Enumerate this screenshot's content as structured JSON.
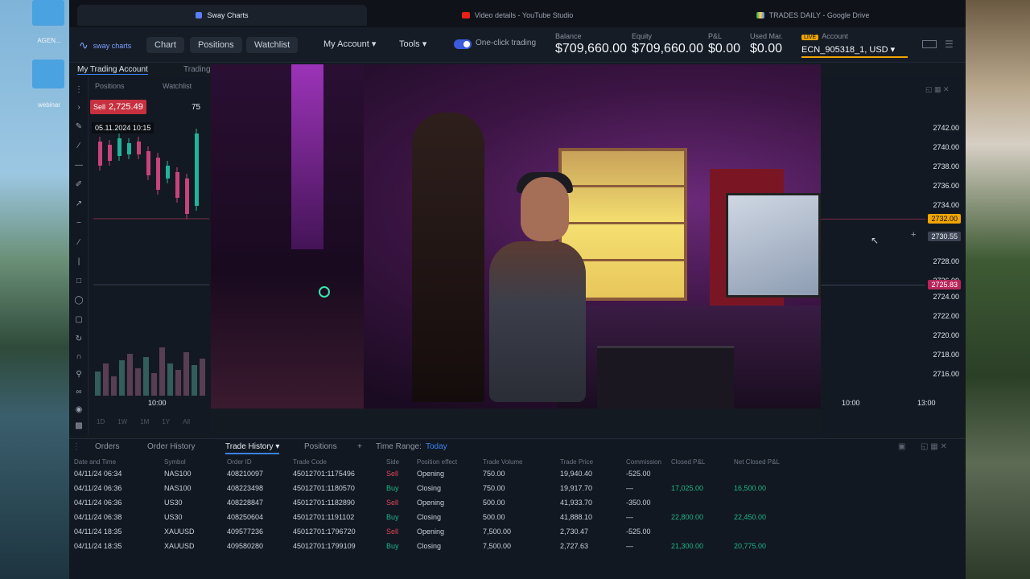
{
  "desktop": {
    "icons": [
      {
        "label": ""
      },
      {
        "label": "AGEN..."
      },
      {
        "label": "webinar"
      }
    ]
  },
  "tabs": [
    {
      "label": "Sway Charts",
      "active": true
    },
    {
      "label": "Video details - YouTube Studio",
      "active": false
    },
    {
      "label": "TRADES DAILY - Google Drive",
      "active": false
    }
  ],
  "header": {
    "logo_text": "sway charts",
    "nav": {
      "chart": "Chart",
      "positions": "Positions",
      "watchlist": "Watchlist"
    },
    "menus": {
      "my_account": "My Account ▾",
      "tools": "Tools ▾"
    },
    "one_click": "One-click trading",
    "stats": [
      {
        "key": "Balance",
        "value": "$709,660.00"
      },
      {
        "key": "Equity",
        "value": "$709,660.00"
      },
      {
        "key": "P&L",
        "value": "$0.00"
      },
      {
        "key": "Used Mar.",
        "value": "$0.00"
      }
    ],
    "account_live": "LIVE",
    "account_label": "Account",
    "account_value": "ECN_905318_1, USD ▾"
  },
  "chart": {
    "sub_tabs": {
      "account": "My Trading Account",
      "trading": "Trading"
    },
    "side_tabs": {
      "positions": "Positions",
      "watchlist": "Watchlist"
    },
    "sell_label": "Sell",
    "sell_price": "2,725.49",
    "quantity": "75",
    "date_badge": "05.11.2024 10:15",
    "price_ticks": [
      "2742.00",
      "2740.00",
      "2738.00",
      "2736.00",
      "2734.00",
      "2728.00",
      "2726.00",
      "2724.00",
      "2722.00",
      "2720.00",
      "2718.00",
      "2716.00"
    ],
    "badge_sell": "2732.00",
    "badge_cur": "2730.55",
    "badge_buy": "2725.83",
    "time_labels": [
      "10:00",
      "10:00",
      "13:00"
    ],
    "periods": [
      "1D",
      "1W",
      "1M",
      "1Y",
      "All"
    ]
  },
  "bottom": {
    "tabs": {
      "orders": "Orders",
      "order_history": "Order History",
      "trade_history": "Trade History ▾",
      "positions": "Positions",
      "time_range_label": "Time Range:",
      "time_range_value": "Today"
    },
    "headers": [
      "Date and Time",
      "Symbol",
      "Order ID",
      "Trade Code",
      "Side",
      "Position effect",
      "Trade Volume",
      "Trade Price",
      "Commission",
      "Closed P&L",
      "Net Closed P&L"
    ],
    "rows": [
      [
        "04/11/24 06:34",
        "NAS100",
        "408210097",
        "45012701:1175496",
        "Sell",
        "Opening",
        "750.00",
        "19,940.40",
        "-525.00",
        "",
        ""
      ],
      [
        "04/11/24 06:36",
        "NAS100",
        "408223498",
        "45012701:1180570",
        "Buy",
        "Closing",
        "750.00",
        "19,917.70",
        "—",
        "17,025.00",
        "16,500.00"
      ],
      [
        "04/11/24 06:36",
        "US30",
        "408228847",
        "45012701:1182890",
        "Sell",
        "Opening",
        "500.00",
        "41,933.70",
        "-350.00",
        "",
        ""
      ],
      [
        "04/11/24 06:38",
        "US30",
        "408250604",
        "45012701:1191102",
        "Buy",
        "Closing",
        "500.00",
        "41,888.10",
        "—",
        "22,800.00",
        "22,450.00"
      ],
      [
        "04/11/24 18:35",
        "XAUUSD",
        "409577236",
        "45012701:1796720",
        "Sell",
        "Opening",
        "7,500.00",
        "2,730.47",
        "-525.00",
        "",
        ""
      ],
      [
        "04/11/24 18:35",
        "XAUUSD",
        "409580280",
        "45012701:1799109",
        "Buy",
        "Closing",
        "7,500.00",
        "2,727.63",
        "—",
        "21,300.00",
        "20,775.00"
      ]
    ]
  }
}
